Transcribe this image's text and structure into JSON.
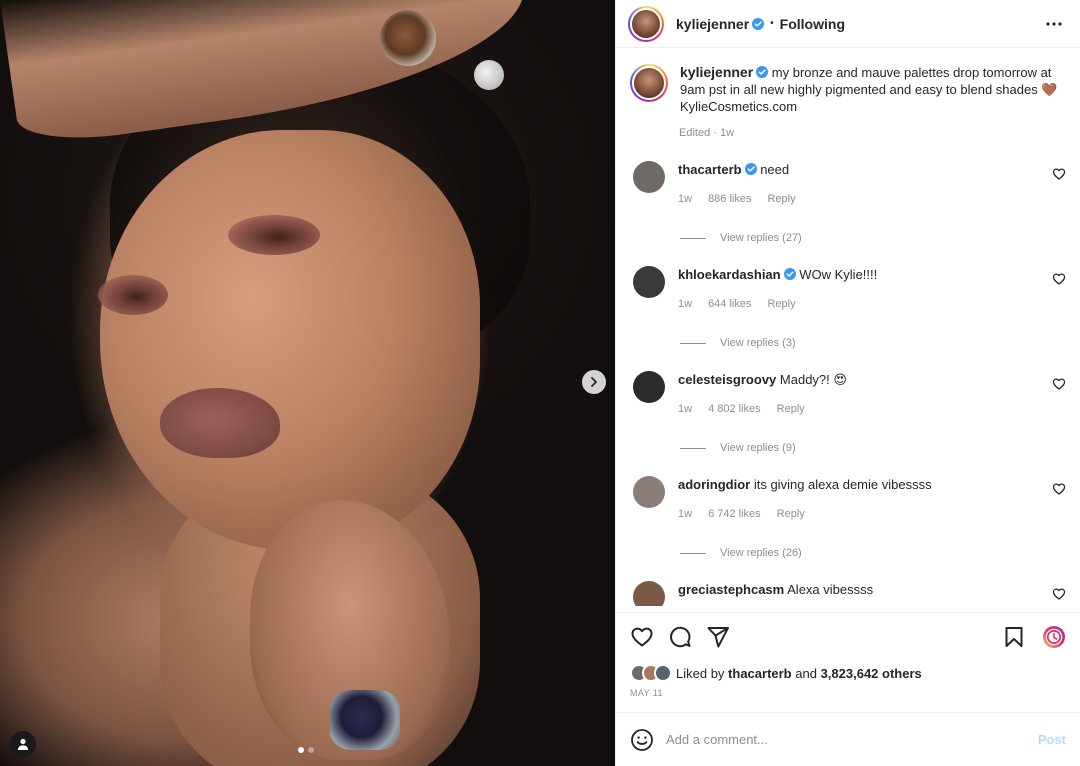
{
  "header": {
    "username": "kyliejenner",
    "separator": "•",
    "follow_status": "Following",
    "more_icon": "more-horizontal-icon"
  },
  "media": {
    "next_icon": "chevron-right-icon",
    "tag_icon": "user-tag-icon",
    "slides_total": 2,
    "slide_active": 1
  },
  "caption": {
    "username": "kyliejenner",
    "text": "my bronze and mauve palettes drop tomorrow at 9am pst in all new highly pigmented and easy to blend shades 🤎 KylieCosmetics.com",
    "meta": "Edited · 1w"
  },
  "comments": [
    {
      "username": "thacarterb",
      "verified": true,
      "text": "need",
      "time": "1w",
      "likes": "886 likes",
      "reply": "Reply",
      "replies": "View replies (27)",
      "avatar_color": "#6f6a66"
    },
    {
      "username": "khloekardashian",
      "verified": true,
      "text": "WOw Kylie!!!!",
      "time": "1w",
      "likes": "644 likes",
      "reply": "Reply",
      "replies": "View replies (3)",
      "avatar_color": "#3a3a3a"
    },
    {
      "username": "celesteisgroovy",
      "verified": false,
      "text": "Maddy?! 😍",
      "time": "1w",
      "likes": "4 802 likes",
      "reply": "Reply",
      "replies": "View replies (9)",
      "avatar_color": "#2b2b2b"
    },
    {
      "username": "adoringdior",
      "verified": false,
      "text": "its giving alexa demie vibessss",
      "time": "1w",
      "likes": "6 742 likes",
      "reply": "Reply",
      "replies": "View replies (26)",
      "avatar_color": "#8a7f78"
    },
    {
      "username": "greciastephcasm",
      "verified": false,
      "text": "Alexa vibessss",
      "avatar_color": "#7a5a45"
    }
  ],
  "actions": {
    "like_icon": "heart-icon",
    "comment_icon": "comment-icon",
    "share_icon": "paper-plane-icon",
    "save_icon": "bookmark-icon",
    "reel_icon": "reels-icon"
  },
  "likes": {
    "prefix": "Liked by",
    "user": "thacarterb",
    "and": "and",
    "others": "3,823,642 others"
  },
  "date": "MAY 11",
  "add_comment": {
    "placeholder": "Add a comment...",
    "post_label": "Post",
    "emoji_icon": "smiley-icon"
  },
  "colors": {
    "verified": "#3897f0",
    "muted": "#8e8e8e",
    "post_disabled": "#b3dbff",
    "reel_accent": "#e1306c"
  }
}
